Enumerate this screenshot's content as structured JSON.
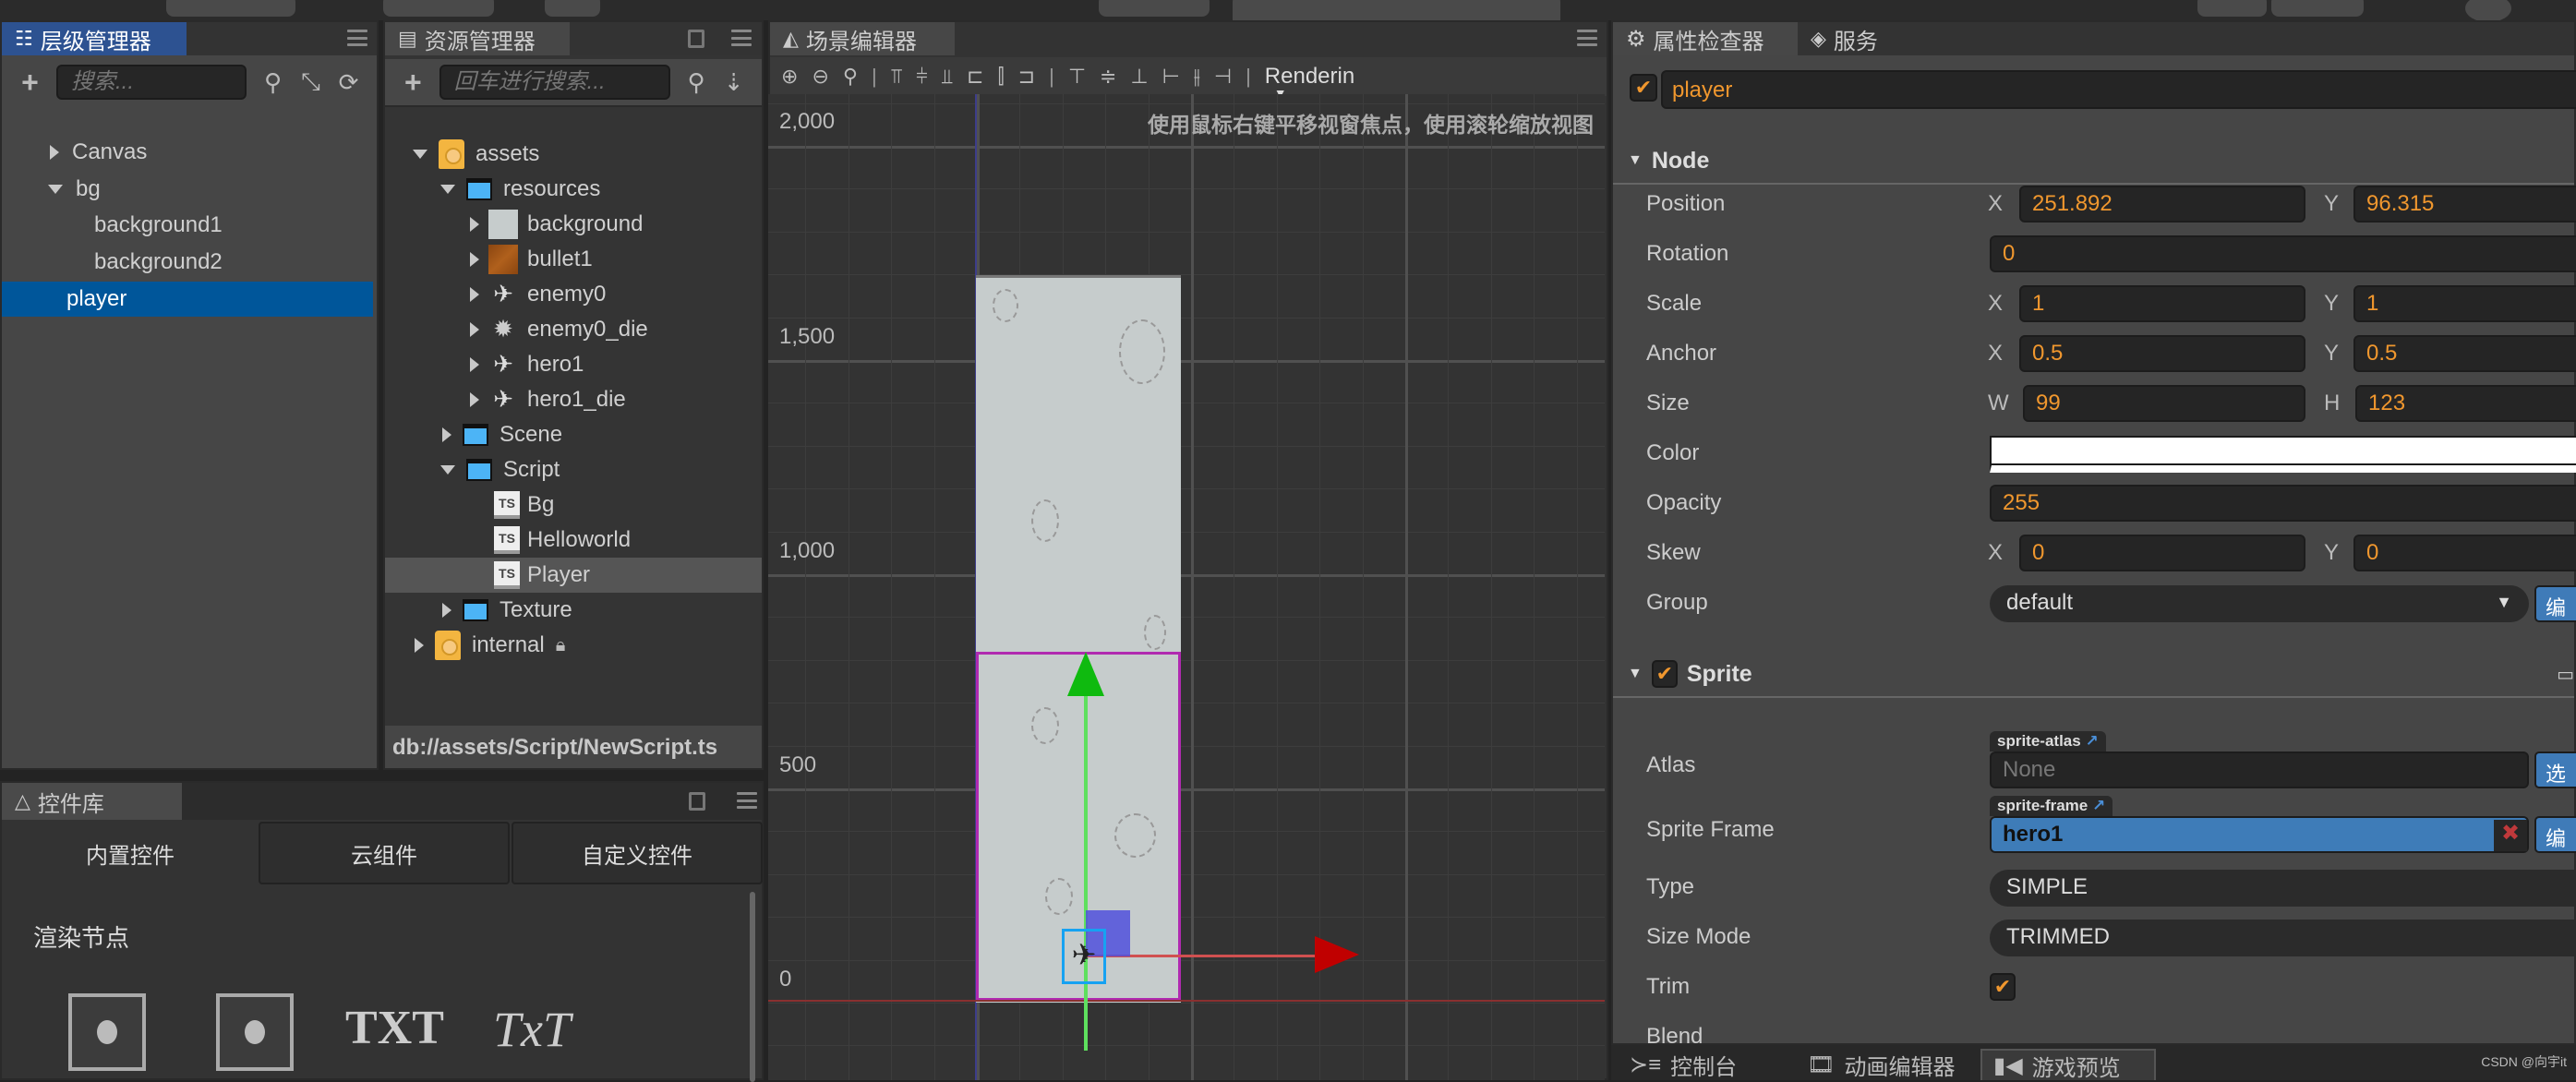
{
  "hierarchy": {
    "tab_label": "层级管理器",
    "search_placeholder": "搜索...",
    "nodes": [
      {
        "label": "Canvas",
        "expanded": false
      },
      {
        "label": "bg",
        "expanded": true
      },
      {
        "label": "background1"
      },
      {
        "label": "background2"
      },
      {
        "label": "player",
        "selected": true
      }
    ]
  },
  "assets": {
    "tab_label": "资源管理器",
    "search_placeholder": "回车进行搜索...",
    "tree": [
      {
        "label": "assets",
        "type": "db"
      },
      {
        "label": "resources",
        "type": "folder"
      },
      {
        "label": "background",
        "type": "texture"
      },
      {
        "label": "bullet1",
        "type": "texture"
      },
      {
        "label": "enemy0",
        "type": "texture"
      },
      {
        "label": "enemy0_die",
        "type": "texture"
      },
      {
        "label": "hero1",
        "type": "texture"
      },
      {
        "label": "hero1_die",
        "type": "texture"
      },
      {
        "label": "Scene",
        "type": "folder"
      },
      {
        "label": "Script",
        "type": "folder"
      },
      {
        "label": "Bg",
        "type": "ts"
      },
      {
        "label": "Helloworld",
        "type": "ts"
      },
      {
        "label": "Player",
        "type": "ts",
        "selected": true
      },
      {
        "label": "Texture",
        "type": "folder"
      },
      {
        "label": "internal",
        "type": "db",
        "locked": true
      }
    ],
    "status_path": "db://assets/Script/NewScript.ts"
  },
  "widgets": {
    "tab_label": "控件库",
    "subtabs": [
      "内置控件",
      "云组件",
      "自定义控件"
    ],
    "section_title": "渲染节点",
    "items": [
      "sprite-icon",
      "sprite-splash-icon",
      "TXT",
      "TxT"
    ]
  },
  "scene": {
    "tab_label": "场景编辑器",
    "rendering_label": "Renderin",
    "hint": "使用鼠标右键平移视窗焦点，使用滚轮缩放视图",
    "y_axis_labels": [
      "2,000",
      "1,500",
      "1,000",
      "500",
      "0"
    ]
  },
  "inspector": {
    "tabs": [
      "属性检查器",
      "服务"
    ],
    "node_name": "player",
    "node_active": true,
    "node_section": "Node",
    "position": {
      "label": "Position",
      "x": "251.892",
      "y": "96.315"
    },
    "rotation": {
      "label": "Rotation",
      "value": "0"
    },
    "scale": {
      "label": "Scale",
      "x": "1",
      "y": "1"
    },
    "anchor": {
      "label": "Anchor",
      "x": "0.5",
      "y": "0.5"
    },
    "size": {
      "label": "Size",
      "w": "99",
      "h": "123"
    },
    "color": {
      "label": "Color",
      "value": "#ffffff"
    },
    "opacity": {
      "label": "Opacity",
      "value": "255"
    },
    "skew": {
      "label": "Skew",
      "x": "0",
      "y": "0"
    },
    "group": {
      "label": "Group",
      "value": "default",
      "button": "编"
    },
    "sprite_section": "Sprite",
    "atlas": {
      "label": "Atlas",
      "tag": "sprite-atlas",
      "value": "None",
      "button": "选"
    },
    "sprite_frame": {
      "label": "Sprite Frame",
      "tag": "sprite-frame",
      "value": "hero1",
      "button": "编"
    },
    "type": {
      "label": "Type",
      "value": "SIMPLE"
    },
    "size_mode": {
      "label": "Size Mode",
      "value": "TRIMMED"
    },
    "trim": {
      "label": "Trim",
      "checked": true
    },
    "blend": {
      "label": "Blend"
    },
    "axis": {
      "x": "X",
      "y": "Y",
      "w": "W",
      "h": "H"
    }
  },
  "bottom_tabs": [
    "控制台",
    "动画编辑器",
    "游戏预览"
  ],
  "watermark": "CSDN @向宇it"
}
